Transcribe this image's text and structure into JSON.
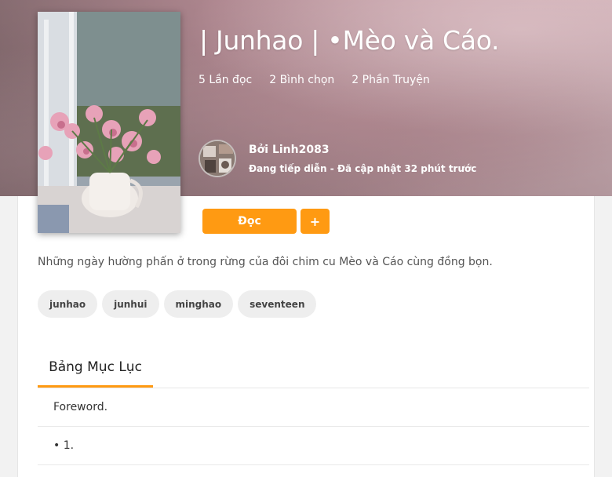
{
  "story": {
    "title": "| Junhao | •Mèo và Cáo.",
    "stats": {
      "reads": "5 Lần đọc",
      "votes": "2 Bình chọn",
      "parts": "2 Phần Truyện"
    },
    "author": {
      "name": "Bởi Linh2083",
      "status": "Đang tiếp diễn - Đã cập nhật 32 phút trước"
    },
    "description": "Những ngày hường phấn ở trong rừng của đôi chim cu Mèo và Cáo cùng đồng bọn.",
    "tags": [
      "junhao",
      "junhui",
      "minghao",
      "seventeen"
    ]
  },
  "actions": {
    "read_label": "Đọc",
    "add_label": "+"
  },
  "toc": {
    "tab_label": "Bảng Mục Lục",
    "items": [
      "Foreword.",
      "• 1."
    ]
  },
  "colors": {
    "accent": "#ff9a12",
    "tag_bg": "#eeeeee"
  }
}
